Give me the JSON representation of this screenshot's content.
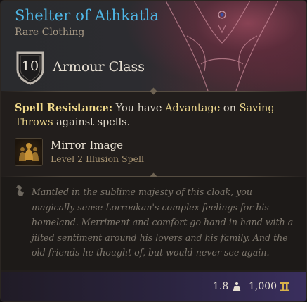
{
  "item": {
    "name": "Shelter of Athkatla",
    "rarity_type": "Rare Clothing",
    "armour_class": {
      "value": "10",
      "label": "Armour Class"
    }
  },
  "properties": {
    "spell_resistance": {
      "label": "Spell Resistance:",
      "text_part1": " You have ",
      "keyword1": "Advantage",
      "text_part2": " on ",
      "keyword2": "Saving Throws",
      "text_part3": " against spells."
    }
  },
  "spell": {
    "name": "Mirror Image",
    "detail": "Level 2 Illusion Spell",
    "icon": "mirror-image-icon"
  },
  "flavor_text": "Mantled in the sublime majesty of this cloak, you magically sense Lorroakan's complex feelings for his homeland. Merriment and comfort go hand in hand with a jilted sentiment around his lovers and his family. And the old friends he thought of, but would never see again.",
  "footer": {
    "weight": "1.8",
    "weight_icon": "weight-icon",
    "value": "1,000",
    "gold_icon": "gold-coin-icon"
  },
  "colors": {
    "title": "#4fb7e6",
    "keyword": "#e8d38a",
    "flavor": "#7d766c"
  }
}
